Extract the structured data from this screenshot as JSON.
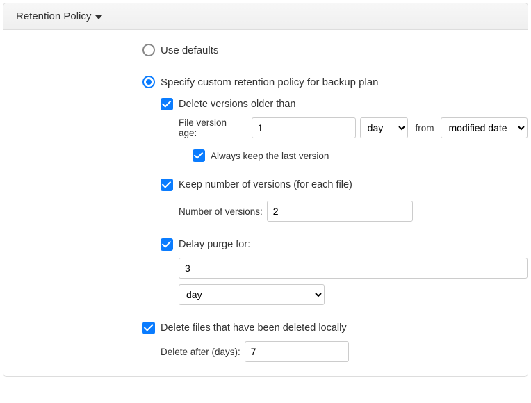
{
  "header": {
    "title": "Retention Policy"
  },
  "options": {
    "use_defaults": "Use defaults",
    "specify_custom": "Specify custom retention policy for backup plan"
  },
  "delete_older": {
    "label": "Delete versions older than",
    "age_label": "File version age:",
    "age_value": "1",
    "unit": "day",
    "from_text": "from",
    "reference": "modified date",
    "always_keep": "Always keep the last version"
  },
  "keep_versions": {
    "label": "Keep number of versions (for each file)",
    "count_label": "Number of versions:",
    "count_value": "2"
  },
  "delay_purge": {
    "label": "Delay purge for:",
    "value": "3",
    "unit": "day"
  },
  "delete_local": {
    "label": "Delete files that have been deleted locally",
    "after_label": "Delete after (days):",
    "after_value": "7"
  }
}
